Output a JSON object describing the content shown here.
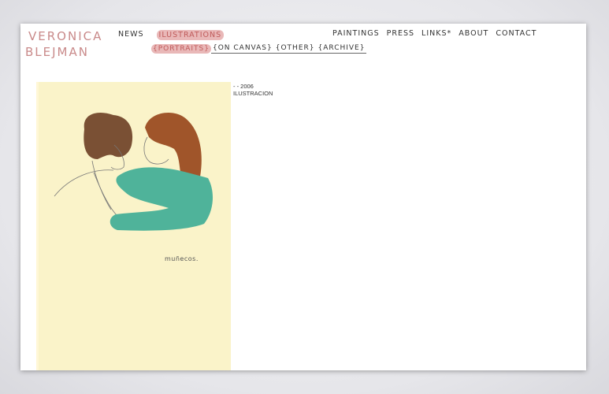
{
  "site": {
    "logo_line1": "VERONICA",
    "logo_line2": "BLEJMAN"
  },
  "nav_left": {
    "news": "NEWS",
    "illustrations": "ILUSTRATIONS"
  },
  "nav_right": {
    "paintings": "PAINTINGS",
    "press": "PRESS",
    "links": "LINKS*",
    "about": "ABOUT",
    "contact": "CONTACT"
  },
  "subnav": {
    "portraits": "{PORTRAITS}",
    "on_canvas": "{ON CANVAS}",
    "other": "{OTHER}",
    "archive": "{ARCHIVE}"
  },
  "artwork": {
    "caption_line1": "- - 2006",
    "caption_line2": "ILUSTRACION",
    "signature": "muñecos.",
    "colors": {
      "paper": "#faf3c9",
      "hair_left": "#7a5034",
      "hair_right": "#a0552a",
      "shirt": "#4fb39a"
    }
  },
  "colors": {
    "accent": "#c98a8a",
    "highlight_bg": "#e9b8b8"
  }
}
